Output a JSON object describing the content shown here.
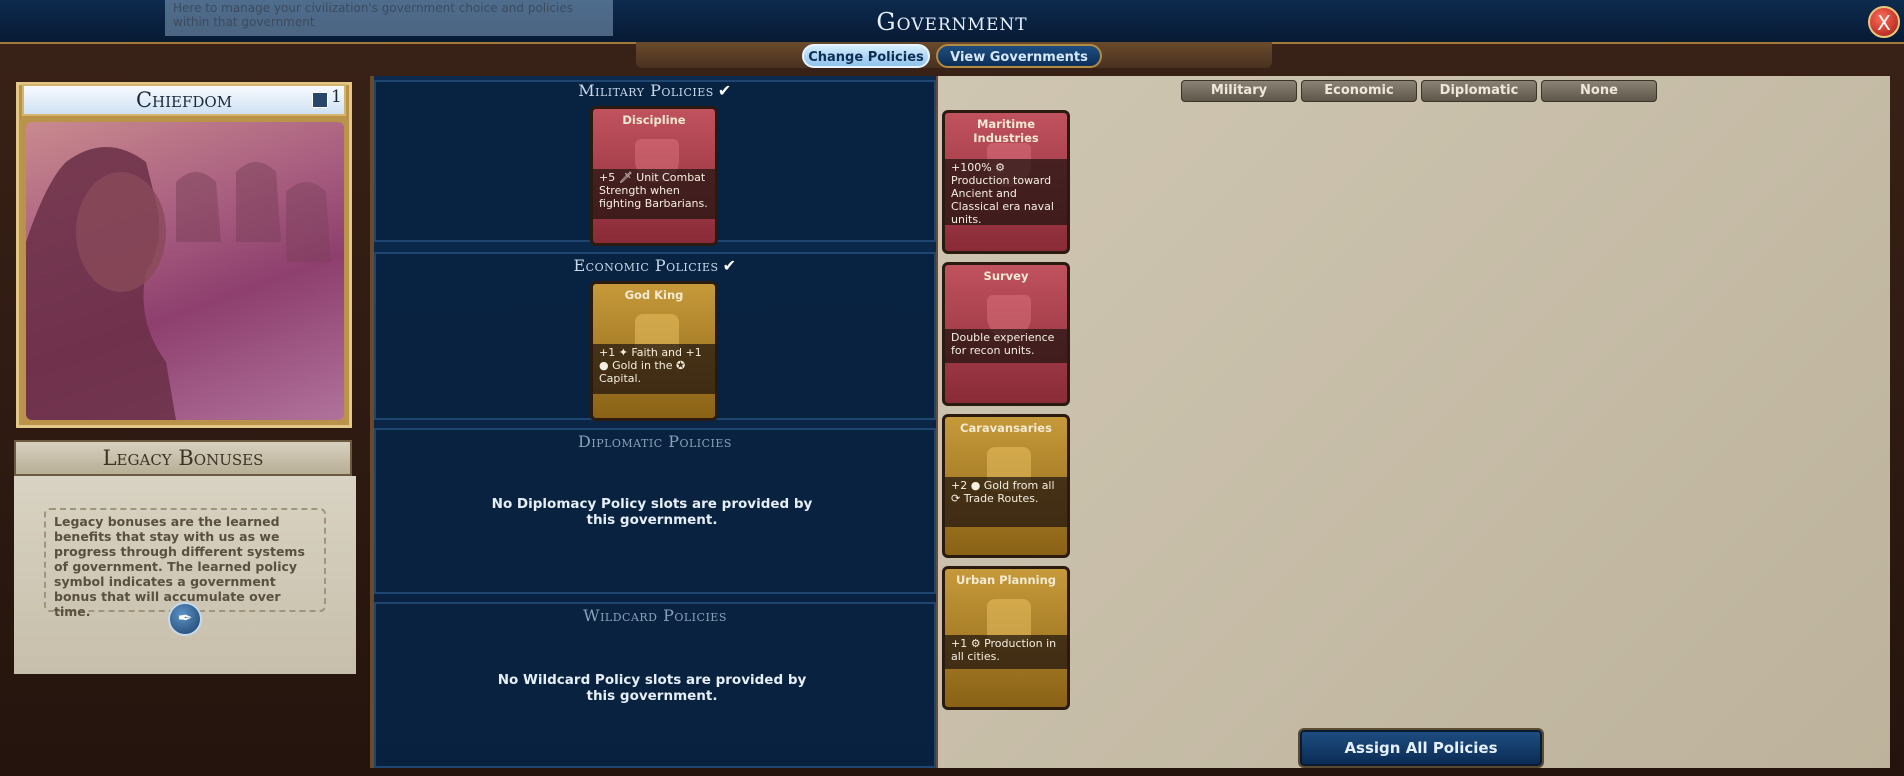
{
  "window": {
    "title": "Government",
    "close_label": "X"
  },
  "tooltip": {
    "text": "Here to manage your civilization's government choice and policies within that government"
  },
  "tabs": [
    {
      "label": "Change Policies",
      "active": true
    },
    {
      "label": "View Governments",
      "active": false
    }
  ],
  "government": {
    "name": "Chiefdom",
    "legacy_count": "1"
  },
  "legacy": {
    "title": "Legacy Bonuses",
    "text": "Legacy bonuses are the learned benefits that stay with us as we progress through different systems of government.  The learned policy symbol indicates a government bonus that will accumulate over time."
  },
  "sections": {
    "military": {
      "title": "Military Policies"
    },
    "economic": {
      "title": "Economic Policies"
    },
    "diplomatic": {
      "title": "Diplomatic Policies",
      "empty": "No Diplomacy Policy slots are provided by this government."
    },
    "wildcard": {
      "title": "Wildcard Policies",
      "empty": "No Wildcard Policy slots are provided by this government."
    }
  },
  "slotted": {
    "military": {
      "title": "Discipline",
      "text": "+5 🗡 Unit Combat Strength when fighting Barbarians."
    },
    "economic": {
      "title": "God King",
      "text": "+1 ✦ Faith and +1 ● Gold in the ✪ Capital."
    }
  },
  "filters": [
    "Military",
    "Economic",
    "Diplomatic",
    "None"
  ],
  "catalog": [
    {
      "title": "Maritime Industries",
      "text": "+100% ⚙ Production toward Ancient and Classical era naval units.",
      "type": "military"
    },
    {
      "title": "Survey",
      "text": "Double experience for recon units.",
      "type": "military"
    },
    {
      "title": "Caravansaries",
      "text": "+2 ● Gold from all ⟳ Trade Routes.",
      "type": "economic"
    },
    {
      "title": "Urban Planning",
      "text": "+1 ⚙ Production in all cities.",
      "type": "economic"
    }
  ],
  "assign_button": "Assign All Policies",
  "colors": {
    "accent_blue": "#0b2a4e",
    "military_card": "#a03a48",
    "economic_card": "#b08a30",
    "parchment": "#c7bea9"
  }
}
